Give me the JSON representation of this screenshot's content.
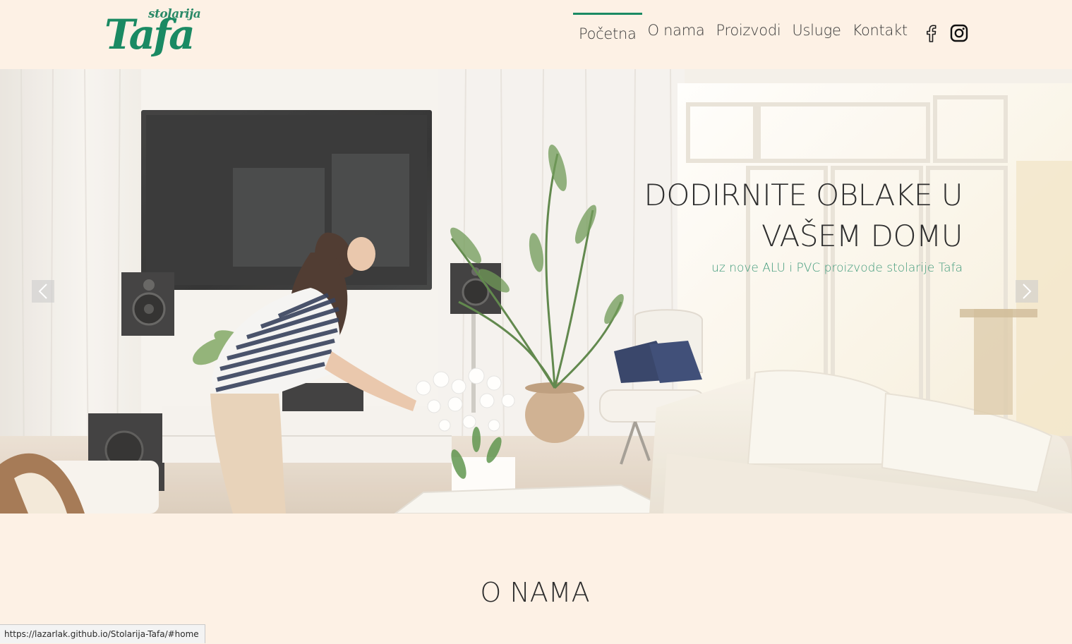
{
  "header": {
    "logo": {
      "script_text": "stolarija",
      "main_text": "Tafa"
    },
    "nav": [
      {
        "label": "Početna",
        "active": true
      },
      {
        "label": "O nama",
        "active": false
      },
      {
        "label": "Proizvodi",
        "active": false
      },
      {
        "label": "Usluge",
        "active": false
      },
      {
        "label": "Kontakt",
        "active": false
      }
    ],
    "social": [
      "facebook-icon",
      "instagram-icon"
    ]
  },
  "hero": {
    "title_line1": "DODIRNITE OBLAKE U",
    "title_line2": "VAŠEM DOMU",
    "subtitle": "uz nove ALU i PVC proizvode stolarije Tafa",
    "prev_icon": "chevron-left-icon",
    "next_icon": "chevron-right-icon"
  },
  "about": {
    "title": "O NAMA"
  },
  "status_bar": {
    "url": "https://lazarlak.github.io/Stolarija-Tafa/#home"
  },
  "colors": {
    "background": "#fdf1e5",
    "accent_green": "#1a8a63",
    "subtitle_green": "#3f9a7a",
    "text_dark": "#2e2e2e"
  }
}
